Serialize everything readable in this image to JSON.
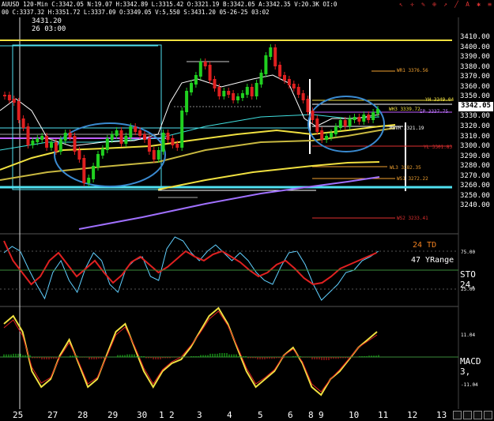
{
  "header": {
    "line1": "AUUSD  120-Min  C:3342.05  N:19.07  H:3342.89  L:3315.42  O:3321.19  B:3342.05  A:3342.35  V:20.3K  OI:0",
    "line2": "00  C:3337.32  H:3351.72  L:3337.09  O:3349.05  V:5,550  S:3431.20  05-26-25  03:02"
  },
  "cursor": {
    "price": "3431.20",
    "time": "26 03:00"
  },
  "price_axis": [
    "3410.00",
    "3400.00",
    "3390.00",
    "3380.00",
    "3370.00",
    "3360.00",
    "3350.00",
    "3340.00",
    "3330.00",
    "3320.00",
    "3310.00",
    "3300.00",
    "3290.00",
    "3280.00",
    "3270.00",
    "3260.00",
    "3250.00",
    "3240.00"
  ],
  "current_price": "3342.05",
  "level_labels": {
    "wr1": "WR1  3376.56",
    "yh": "YH  3349.04",
    "wh3": "WH3  3339.72",
    "ip": "IP  3337.75",
    "rovr": "ROVR  3321.19",
    "yl": "YL  3301.83",
    "wl3": "WL3  3282.35",
    "ws1": "WS1  3272.22",
    "ws2": "WS2  3233.41"
  },
  "indicators": {
    "td": "24 TD",
    "yrange": "47 YRange",
    "sto": "STO  24,",
    "sto_hi": "75.00",
    "sto_lo": "25.00",
    "macd": "MACD 3,",
    "macd_hi": "11.04",
    "macd_lo": "-11.04"
  },
  "x_axis": [
    "25",
    "27",
    "28",
    "29",
    "30",
    "1",
    "2",
    "3",
    "4",
    "5",
    "6",
    "8",
    "9",
    "10",
    "11",
    "12",
    "13"
  ],
  "colors": {
    "up": "#20d020",
    "down": "#e02020",
    "yellow": "#f0e040",
    "cyan": "#50e0f0",
    "purple": "#a070ff"
  }
}
